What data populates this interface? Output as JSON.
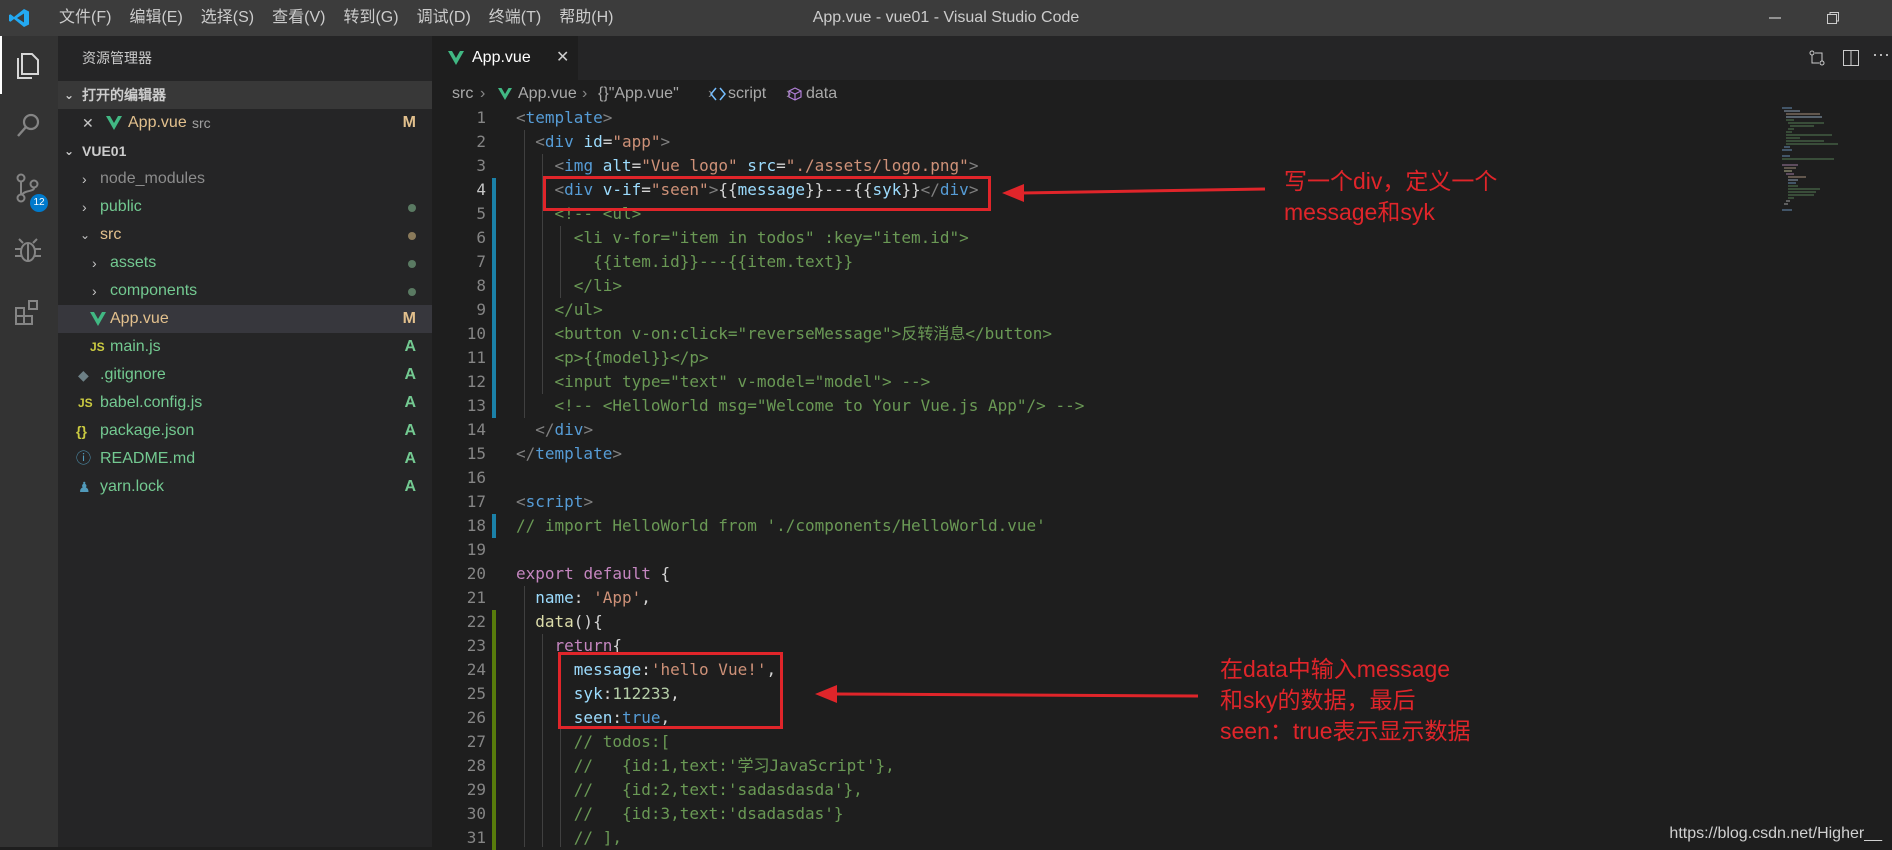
{
  "titlebar": {
    "menu": [
      "文件(F)",
      "编辑(E)",
      "选择(S)",
      "查看(V)",
      "转到(G)",
      "调试(D)",
      "终端(T)",
      "帮助(H)"
    ],
    "title": "App.vue - vue01 - Visual Studio Code"
  },
  "activitybar": {
    "icons": [
      "explorer-icon",
      "search-icon",
      "source-control-icon",
      "debug-icon",
      "extensions-icon"
    ],
    "scm_badge": "12"
  },
  "sidebar": {
    "title": "资源管理器",
    "open_editors_header": "打开的编辑器",
    "open_editor": {
      "name": "App.vue",
      "dir": "src",
      "status": "M"
    },
    "project_header": "VUE01",
    "tree": [
      {
        "name": "node_modules",
        "kind": "folder",
        "status": ""
      },
      {
        "name": "public",
        "kind": "folder",
        "status": "dot"
      },
      {
        "name": "src",
        "kind": "folder-open",
        "status": "dot"
      },
      {
        "name": "assets",
        "kind": "folder",
        "status": "dot"
      },
      {
        "name": "components",
        "kind": "folder",
        "status": "dot"
      },
      {
        "name": "App.vue",
        "kind": "vue",
        "status": "M"
      },
      {
        "name": "main.js",
        "kind": "js",
        "status": "A"
      },
      {
        "name": ".gitignore",
        "kind": "git",
        "status": "A"
      },
      {
        "name": "babel.config.js",
        "kind": "js",
        "status": "A"
      },
      {
        "name": "package.json",
        "kind": "json",
        "status": "A"
      },
      {
        "name": "README.md",
        "kind": "info",
        "status": "A"
      },
      {
        "name": "yarn.lock",
        "kind": "yarn",
        "status": "A"
      }
    ]
  },
  "tab": {
    "label": "App.vue",
    "close": "✕"
  },
  "breadcrumb": {
    "src": "src",
    "file": "App.vue",
    "obj": "{}\"App.vue\"",
    "script": "script",
    "data": "data"
  },
  "code_lines": [
    "<template>",
    "  <div id=\"app\">",
    "    <img alt=\"Vue logo\" src=\"./assets/logo.png\">",
    "    <div v-if=\"seen\">{{message}}---{{syk}}</div>",
    "    <!-- <ul>",
    "      <li v-for=\"item in todos\" :key=\"item.id\">",
    "        {{item.id}}---{{item.text}}",
    "      </li>",
    "    </ul>",
    "    <button v-on:click=\"reverseMessage\">反转消息</button>",
    "    <p>{{model}}</p>",
    "    <input type=\"text\" v-model=\"model\"> -->",
    "    <!-- <HelloWorld msg=\"Welcome to Your Vue.js App\"/> -->",
    "  </div>",
    "</template>",
    "",
    "<script>",
    "// import HelloWorld from './components/HelloWorld.vue'",
    "",
    "export default {",
    "  name: 'App',",
    "  data(){",
    "    return{",
    "      message:'hello Vue!',",
    "      syk:112233,",
    "      seen:true,",
    "      // todos:[",
    "      //   {id:1,text:'学习JavaScript'},",
    "      //   {id:2,text:'sadasdasda'},",
    "      //   {id:3,text:'dsadasdas'}",
    "      // ],"
  ],
  "annotations": {
    "note1": [
      "写一个div，定义一个",
      "message和syk"
    ],
    "note2": [
      "在data中输入message",
      "和sky的数据，最后",
      "seen：true表示显示数据"
    ]
  },
  "watermark": "https://blog.csdn.net/Higher__",
  "colors": {
    "accent": "#007acc",
    "annotation": "#e0252a",
    "vue": "#41b883",
    "git_added": "#73c991",
    "git_modified": "#e2c08d"
  }
}
